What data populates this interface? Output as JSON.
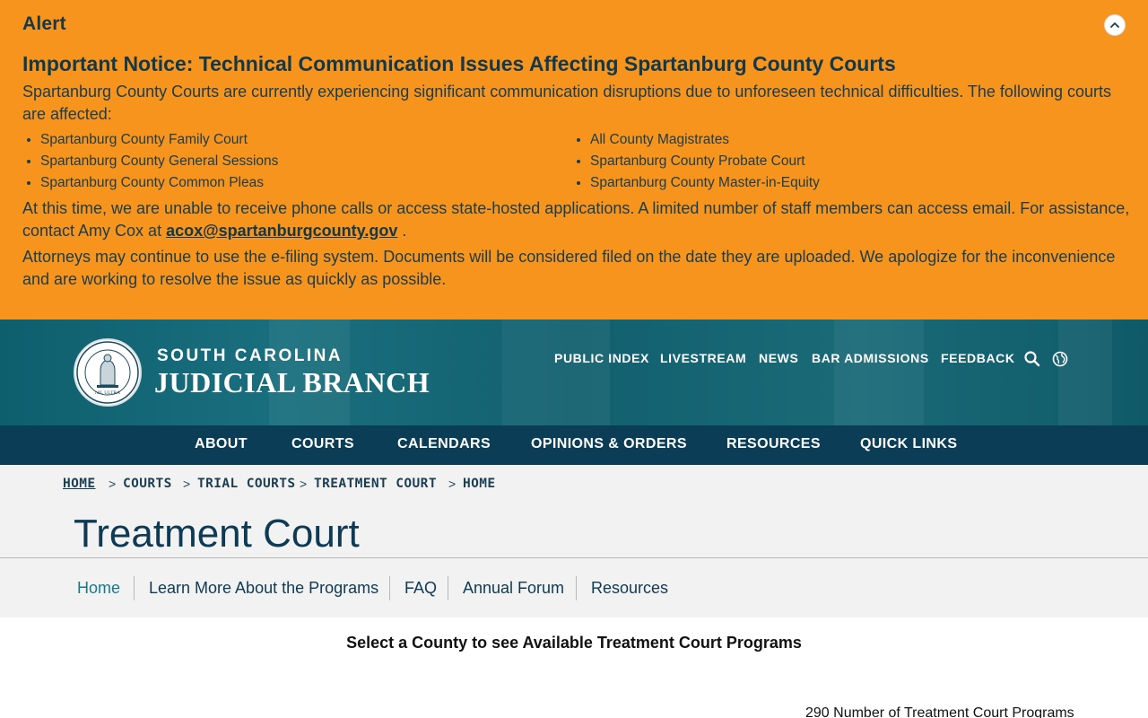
{
  "alert": {
    "title": "Alert",
    "heading": "Important Notice: Technical Communication Issues Affecting Spartanburg County Courts",
    "intro": "Spartanburg County Courts are currently experiencing significant communication disruptions due to unforeseen technical difficulties. The following courts are affected:",
    "courts_left": [
      "Spartanburg County Family Court",
      "Spartanburg County General Sessions",
      "Spartanburg County Common Pleas"
    ],
    "courts_right": [
      "All County Magistrates",
      "Spartanburg County Probate Court",
      "Spartanburg County Master-in-Equity"
    ],
    "p2_text": "At this time, we are unable to receive phone calls or access state-hosted applications. A limited number of staff members can access email. For assistance, contact Amy Cox at ",
    "p2_email": "acox@spartanburgcounty.gov",
    "p2_end": " .",
    "p3": "Attorneys may continue to use the e-filing system. Documents will be considered filed on the date they are uploaded. We apologize for the inconvenience and are working to resolve the issue as quickly as possible.",
    "toggle_icon": "chevron-up-icon",
    "background_color": "#f7941d"
  },
  "header": {
    "brand_top": "SOUTH CAROLINA",
    "brand_main": "JUDICIAL BRANCH",
    "seal_icon": "supreme-court-seal-icon",
    "seal_text": "NIL ULTRA",
    "utility_links": [
      "PUBLIC INDEX",
      "LIVESTREAM",
      "NEWS",
      "BAR ADMISSIONS",
      "FEEDBACK"
    ],
    "search_icon": "search-icon",
    "language_icon": "globe-icon"
  },
  "main_nav": [
    "ABOUT",
    "COURTS",
    "CALENDARS",
    "OPINIONS & ORDERS",
    "RESOURCES",
    "QUICK LINKS"
  ],
  "breadcrumb": [
    "HOME",
    "COURTS",
    "TRIAL COURTS",
    "TREATMENT COURT",
    "HOME"
  ],
  "breadcrumb_separator": ">",
  "page_title": "Treatment Court",
  "sub_nav": [
    "Home",
    "Learn More About the Programs",
    "FAQ",
    "Annual Forum",
    "Resources"
  ],
  "content": {
    "select_heading": "Select a County to see Available Treatment Court Programs",
    "program_count": "290 Number of Treatment Court Programs"
  },
  "colors": {
    "alert_bg": "#f7941d",
    "header_bg": "#12606f",
    "nav_bg": "#0b3d57",
    "title_color": "#0e3a54",
    "active_subnav": "#18798a"
  }
}
